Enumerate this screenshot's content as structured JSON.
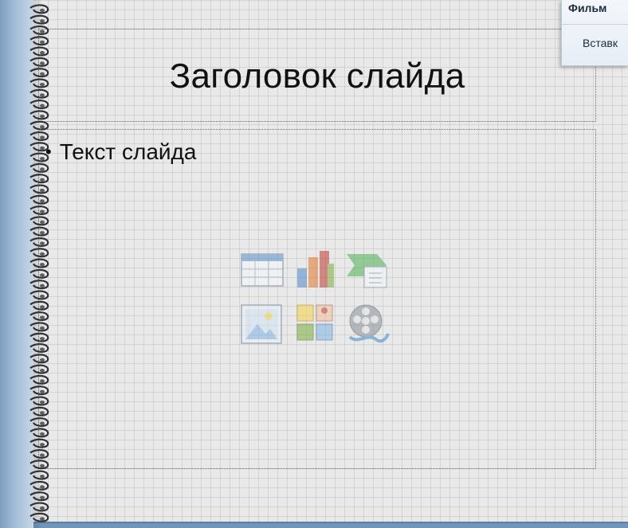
{
  "ribbon": {
    "tab_title": "Фильм",
    "insert_label": "Вставк"
  },
  "slide": {
    "title": "Заголовок слайда",
    "body_bullet": "Текст слайда",
    "bullet_glyph": "•",
    "insert_icons": [
      "insert-table-icon",
      "insert-chart-icon",
      "insert-smartart-icon",
      "insert-picture-icon",
      "insert-clipart-icon",
      "insert-media-icon"
    ]
  },
  "colors": {
    "slide_bg": "#e9e9e9",
    "grid": "#a0a0a0",
    "frame_blue": "#86a9cb",
    "text": "#111111"
  }
}
